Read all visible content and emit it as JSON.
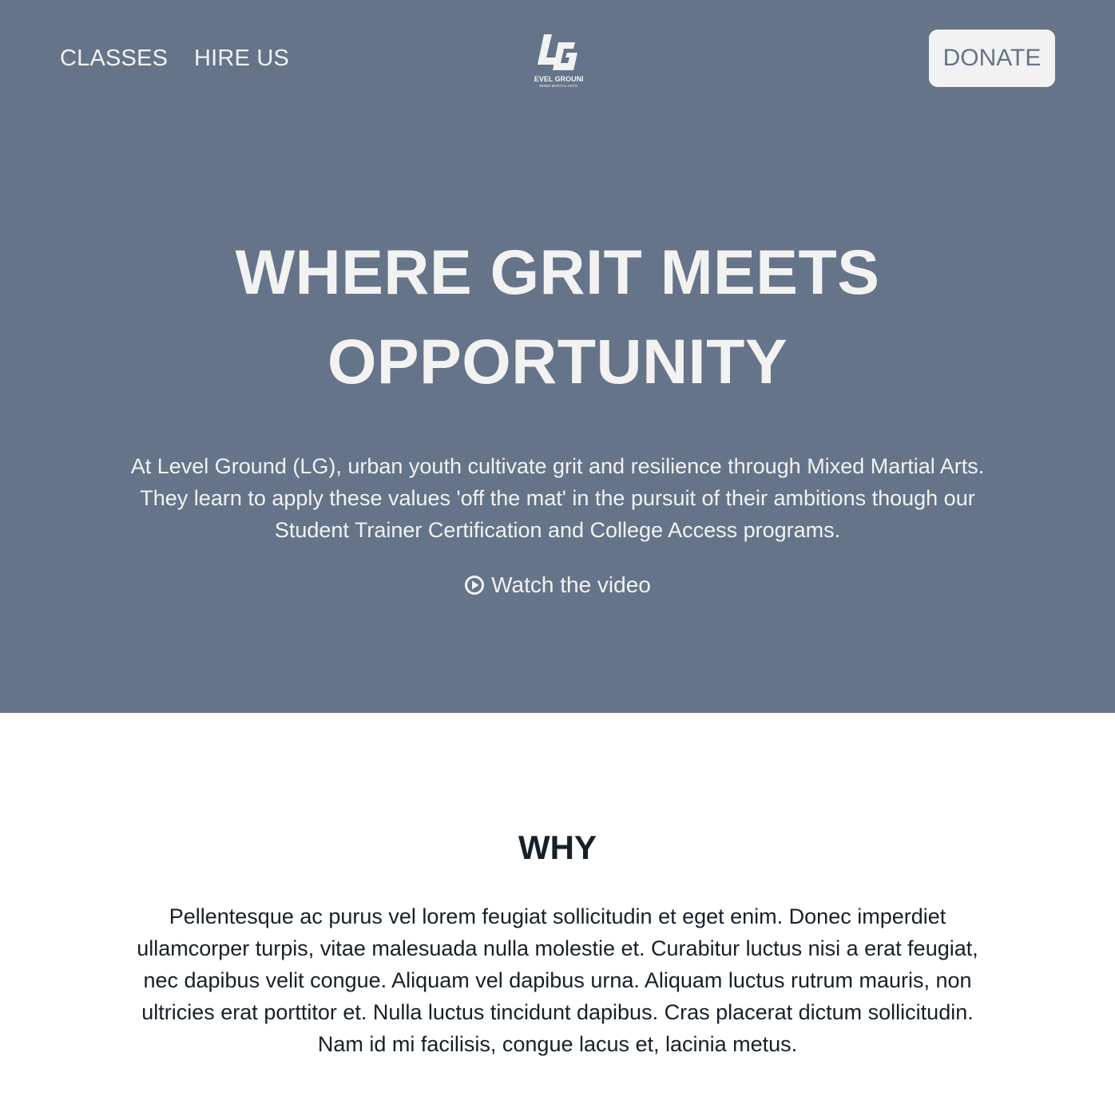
{
  "nav": {
    "links": [
      "CLASSES",
      "HIRE US"
    ],
    "logo": {
      "mark": "LG",
      "name": "LEVEL GROUND",
      "tagline": "MIXED MARTIAL ARTS"
    },
    "donate_label": "DONATE"
  },
  "hero": {
    "title_line1": "WHERE GRIT MEETS",
    "title_line2": "OPPORTUNITY",
    "text": "At Level Ground (LG), urban youth cultivate grit and resilience through Mixed Martial Arts. They learn to apply these values 'off the mat' in the pursuit of their ambitions though our Student Trainer Certification and College Access programs.",
    "video_icon": "play-circle-icon",
    "video_label": "Watch the video"
  },
  "why": {
    "title": "WHY",
    "text": "Pellentesque ac purus vel lorem feugiat sollicitudin et eget enim. Donec imperdiet ullamcorper turpis, vitae malesuada nulla molestie et. Curabitur luctus nisi a erat feugiat, nec dapibus velit congue. Aliquam vel dapibus urna. Aliquam luctus rutrum mauris, non ultricies erat porttitor et. Nulla luctus tincidunt dapibus. Cras placerat dictum sollicitudin. Nam id mi facilisis, congue lacus et, lacinia metus."
  },
  "colors": {
    "hero_bg": "#657489",
    "hero_text": "#f2f2f2",
    "body_text": "#16202a",
    "button_bg": "#f2f2f2"
  }
}
